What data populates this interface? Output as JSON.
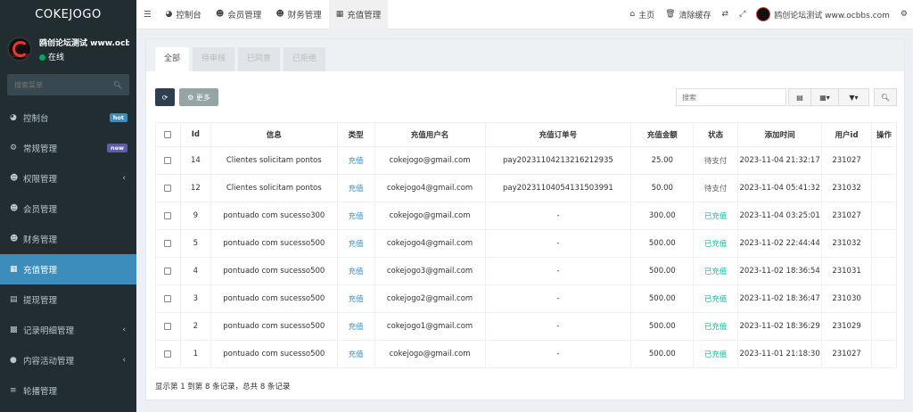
{
  "app": {
    "logo": "COKEJOGO"
  },
  "user": {
    "name": "鸥创论坛测试 www.ocbbs",
    "status": "在线"
  },
  "sidebar": {
    "search_placeholder": "搜索菜单",
    "items": [
      {
        "label": "控制台",
        "icon": "dashboard-icon",
        "badge": "hot",
        "badge_color": "#3c8dbc"
      },
      {
        "label": "常规管理",
        "icon": "cogs-icon",
        "badge": "new",
        "badge_color": "#605ca8"
      },
      {
        "label": "权限管理",
        "icon": "group-icon",
        "arrow": true
      },
      {
        "label": "会员管理",
        "icon": "user-icon"
      },
      {
        "label": "财务管理",
        "icon": "user-icon"
      },
      {
        "label": "充值管理",
        "icon": "grid-icon",
        "active": true
      },
      {
        "label": "提现管理",
        "icon": "bank-icon"
      },
      {
        "label": "记录明细管理",
        "icon": "bar-chart-icon",
        "arrow": true
      },
      {
        "label": "内容活动管理",
        "icon": "circle-icon",
        "arrow": true
      },
      {
        "label": "轮播管理",
        "icon": "list-icon"
      }
    ]
  },
  "topbar": {
    "tabs": [
      "控制台",
      "会员管理",
      "财务管理",
      "充值管理"
    ],
    "home": "主页",
    "clear_cache": "清除缓存",
    "user_name": "鸥创论坛测试 www.ocbbs.com"
  },
  "filter_tabs": [
    "全部",
    "待审核",
    "已同意",
    "已拒绝"
  ],
  "toolbar": {
    "more": "更多",
    "search_placeholder": "搜索"
  },
  "table": {
    "headers": [
      "Id",
      "信息",
      "类型",
      "充值用户名",
      "充值订单号",
      "充值金额",
      "状态",
      "添加时间",
      "用户id",
      "操作"
    ],
    "rows": [
      {
        "id": "14",
        "info": "Clientes solicitam pontos",
        "type": "充值",
        "user": "cokejogo@gmail.com",
        "order": "pay20231104213216212935",
        "amount": "25.00",
        "status": "待支付",
        "time": "2023-11-04 21:32:17",
        "uid": "231027"
      },
      {
        "id": "12",
        "info": "Clientes solicitam pontos",
        "type": "充值",
        "user": "cokejogo4@gmail.com",
        "order": "pay20231104054131503991",
        "amount": "50.00",
        "status": "待支付",
        "time": "2023-11-04 05:41:32",
        "uid": "231032"
      },
      {
        "id": "9",
        "info": "pontuado com sucesso300",
        "type": "充值",
        "user": "cokejogo@gmail.com",
        "order": "-",
        "amount": "300.00",
        "status": "已充值",
        "time": "2023-11-04 03:25:01",
        "uid": "231027"
      },
      {
        "id": "5",
        "info": "pontuado com sucesso500",
        "type": "充值",
        "user": "cokejogo4@gmail.com",
        "order": "-",
        "amount": "500.00",
        "status": "已充值",
        "time": "2023-11-02 22:44:44",
        "uid": "231032"
      },
      {
        "id": "4",
        "info": "pontuado com sucesso500",
        "type": "充值",
        "user": "cokejogo3@gmail.com",
        "order": "-",
        "amount": "500.00",
        "status": "已充值",
        "time": "2023-11-02 18:36:54",
        "uid": "231031"
      },
      {
        "id": "3",
        "info": "pontuado com sucesso500",
        "type": "充值",
        "user": "cokejogo2@gmail.com",
        "order": "-",
        "amount": "500.00",
        "status": "已充值",
        "time": "2023-11-02 18:36:47",
        "uid": "231030"
      },
      {
        "id": "2",
        "info": "pontuado com sucesso500",
        "type": "充值",
        "user": "cokejogo1@gmail.com",
        "order": "-",
        "amount": "500.00",
        "status": "已充值",
        "time": "2023-11-02 18:36:29",
        "uid": "231029"
      },
      {
        "id": "1",
        "info": "pontuado com sucesso500",
        "type": "充值",
        "user": "cokejogo@gmail.com",
        "order": "-",
        "amount": "500.00",
        "status": "已充值",
        "time": "2023-11-01 21:18:30",
        "uid": "231027"
      }
    ],
    "footer": "显示第 1 到第 8 条记录，总共 8 条记录"
  }
}
